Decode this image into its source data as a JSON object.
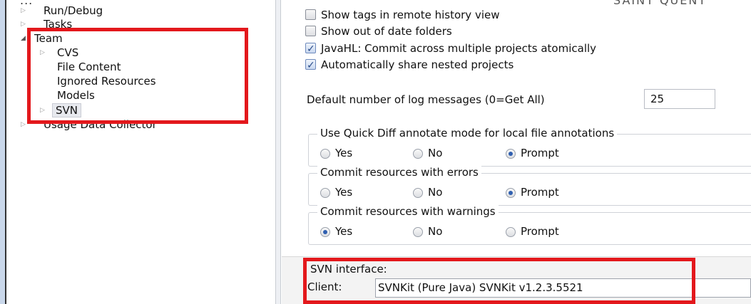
{
  "top_partial": {
    "left": "...",
    "right": "SAINT QUENT"
  },
  "tree": {
    "run_debug": "Run/Debug",
    "tasks": "Tasks",
    "team": "Team",
    "cvs": "CVS",
    "file_content": "File Content",
    "ignored_resources": "Ignored Resources",
    "models": "Models",
    "svn": "SVN",
    "usage": "Usage Data Collector"
  },
  "options": {
    "show_tags": {
      "label": "Show tags in remote history view",
      "checked": false
    },
    "show_out_of_date": {
      "label": "Show out of date folders",
      "checked": false
    },
    "javahl_commit": {
      "label": "JavaHL: Commit across multiple projects atomically",
      "checked": true
    },
    "auto_share": {
      "label": "Automatically share nested projects",
      "checked": true
    }
  },
  "log_messages": {
    "label": "Default number of log messages (0=Get All)",
    "value": "25"
  },
  "groups": [
    {
      "title": "Use Quick Diff annotate mode for local file annotations",
      "options": [
        "Yes",
        "No",
        "Prompt"
      ],
      "selected": "Prompt"
    },
    {
      "title": "Commit resources with errors",
      "options": [
        "Yes",
        "No",
        "Prompt"
      ],
      "selected": "Prompt"
    },
    {
      "title": "Commit resources with warnings",
      "options": [
        "Yes",
        "No",
        "Prompt"
      ],
      "selected": "Yes"
    }
  ],
  "svn_interface": {
    "heading": "SVN interface:",
    "client_label": "Client:",
    "client_value": "SVNKit (Pure Java) SVNKit v1.2.3.5521"
  },
  "colors": {
    "highlight": "#e3181c",
    "radio_selected": "#2f5fb0"
  }
}
